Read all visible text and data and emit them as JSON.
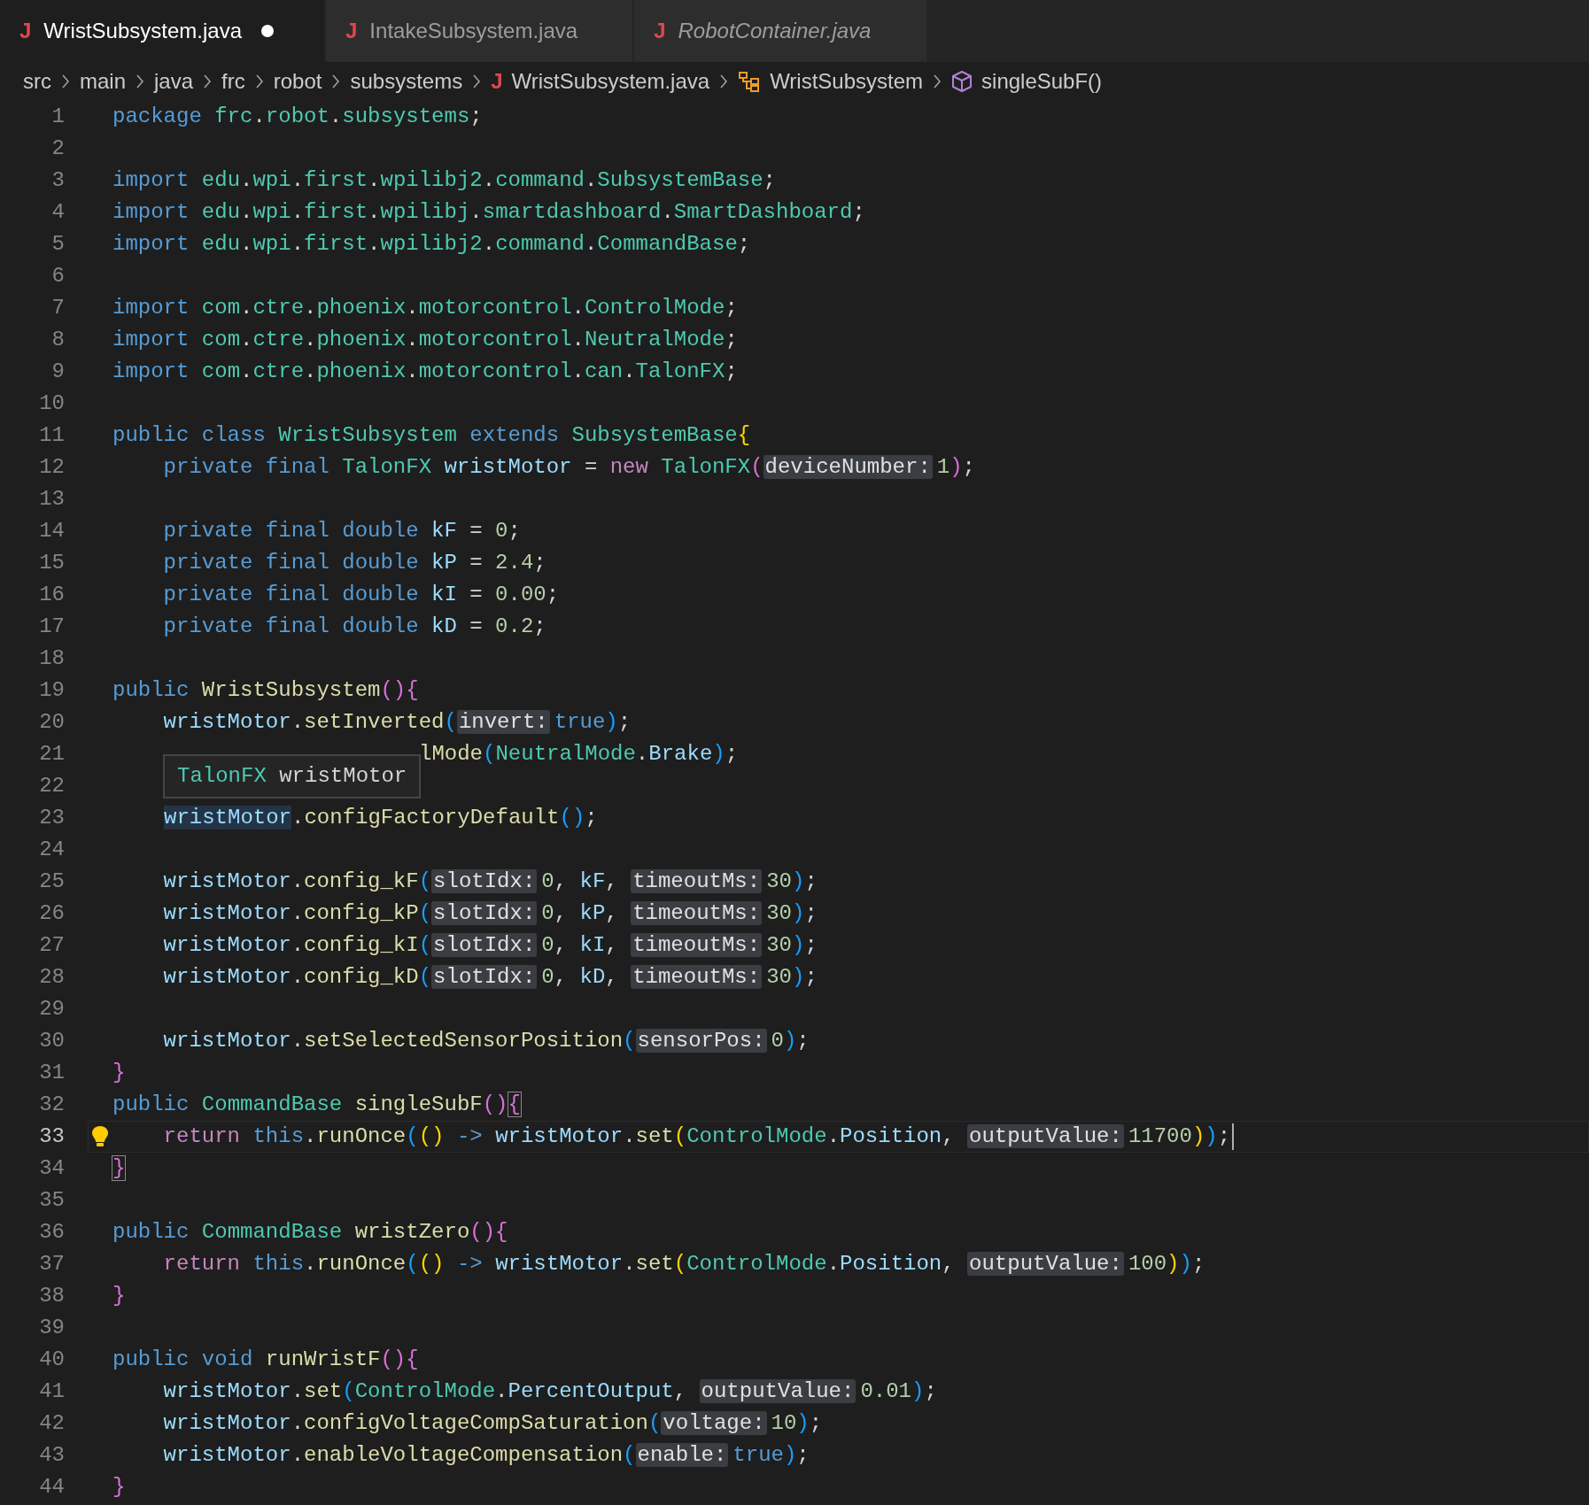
{
  "tabs": [
    {
      "icon": "J",
      "label": "WristSubsystem.java",
      "selected": true,
      "modified": true,
      "preview": false
    },
    {
      "icon": "J",
      "label": "IntakeSubsystem.java",
      "selected": false,
      "modified": false,
      "preview": false
    },
    {
      "icon": "J",
      "label": "RobotContainer.java",
      "selected": false,
      "modified": false,
      "preview": true
    }
  ],
  "breadcrumb": [
    {
      "kind": "folder",
      "label": "src"
    },
    {
      "kind": "folder",
      "label": "main"
    },
    {
      "kind": "folder",
      "label": "java"
    },
    {
      "kind": "folder",
      "label": "frc"
    },
    {
      "kind": "folder",
      "label": "robot"
    },
    {
      "kind": "folder",
      "label": "subsystems"
    },
    {
      "kind": "file",
      "icon": "J",
      "label": "WristSubsystem.java"
    },
    {
      "kind": "class",
      "label": "WristSubsystem"
    },
    {
      "kind": "method",
      "label": "singleSubF()"
    }
  ],
  "lines": [
    {
      "n": "1",
      "tokens": [
        {
          "kind": "kw",
          "text": "package "
        },
        {
          "kind": "ty",
          "text": "frc"
        },
        {
          "kind": "p",
          "text": "."
        },
        {
          "kind": "ty",
          "text": "robot"
        },
        {
          "kind": "p",
          "text": "."
        },
        {
          "kind": "ty",
          "text": "subsystems"
        },
        {
          "kind": "p",
          "text": ";"
        }
      ]
    },
    {
      "n": "2"
    },
    {
      "n": "3",
      "tokens": [
        {
          "kind": "kw",
          "text": "import "
        },
        {
          "kind": "ty",
          "text": "edu"
        },
        {
          "kind": "p",
          "text": "."
        },
        {
          "kind": "ty",
          "text": "wpi"
        },
        {
          "kind": "p",
          "text": "."
        },
        {
          "kind": "ty",
          "text": "first"
        },
        {
          "kind": "p",
          "text": "."
        },
        {
          "kind": "ty",
          "text": "wpilibj2"
        },
        {
          "kind": "p",
          "text": "."
        },
        {
          "kind": "ty",
          "text": "command"
        },
        {
          "kind": "p",
          "text": "."
        },
        {
          "kind": "ty",
          "text": "SubsystemBase"
        },
        {
          "kind": "p",
          "text": ";"
        }
      ]
    },
    {
      "n": "4",
      "tokens": [
        {
          "kind": "kw",
          "text": "import "
        },
        {
          "kind": "ty",
          "text": "edu"
        },
        {
          "kind": "p",
          "text": "."
        },
        {
          "kind": "ty",
          "text": "wpi"
        },
        {
          "kind": "p",
          "text": "."
        },
        {
          "kind": "ty",
          "text": "first"
        },
        {
          "kind": "p",
          "text": "."
        },
        {
          "kind": "ty",
          "text": "wpilibj"
        },
        {
          "kind": "p",
          "text": "."
        },
        {
          "kind": "ty",
          "text": "smartdashboard"
        },
        {
          "kind": "p",
          "text": "."
        },
        {
          "kind": "ty",
          "text": "SmartDashboard"
        },
        {
          "kind": "p",
          "text": ";"
        }
      ]
    },
    {
      "n": "5",
      "tokens": [
        {
          "kind": "kw",
          "text": "import "
        },
        {
          "kind": "ty",
          "text": "edu"
        },
        {
          "kind": "p",
          "text": "."
        },
        {
          "kind": "ty",
          "text": "wpi"
        },
        {
          "kind": "p",
          "text": "."
        },
        {
          "kind": "ty",
          "text": "first"
        },
        {
          "kind": "p",
          "text": "."
        },
        {
          "kind": "ty",
          "text": "wpilibj2"
        },
        {
          "kind": "p",
          "text": "."
        },
        {
          "kind": "ty",
          "text": "command"
        },
        {
          "kind": "p",
          "text": "."
        },
        {
          "kind": "ty",
          "text": "CommandBase"
        },
        {
          "kind": "p",
          "text": ";"
        }
      ]
    },
    {
      "n": "6"
    },
    {
      "n": "7",
      "tokens": [
        {
          "kind": "kw",
          "text": "import "
        },
        {
          "kind": "ty",
          "text": "com"
        },
        {
          "kind": "p",
          "text": "."
        },
        {
          "kind": "ty",
          "text": "ctre"
        },
        {
          "kind": "p",
          "text": "."
        },
        {
          "kind": "ty",
          "text": "phoenix"
        },
        {
          "kind": "p",
          "text": "."
        },
        {
          "kind": "ty",
          "text": "motorcontrol"
        },
        {
          "kind": "p",
          "text": "."
        },
        {
          "kind": "ty",
          "text": "ControlMode"
        },
        {
          "kind": "p",
          "text": ";"
        }
      ]
    },
    {
      "n": "8",
      "tokens": [
        {
          "kind": "kw",
          "text": "import "
        },
        {
          "kind": "ty",
          "text": "com"
        },
        {
          "kind": "p",
          "text": "."
        },
        {
          "kind": "ty",
          "text": "ctre"
        },
        {
          "kind": "p",
          "text": "."
        },
        {
          "kind": "ty",
          "text": "phoenix"
        },
        {
          "kind": "p",
          "text": "."
        },
        {
          "kind": "ty",
          "text": "motorcontrol"
        },
        {
          "kind": "p",
          "text": "."
        },
        {
          "kind": "ty",
          "text": "NeutralMode"
        },
        {
          "kind": "p",
          "text": ";"
        }
      ]
    },
    {
      "n": "9",
      "tokens": [
        {
          "kind": "kw",
          "text": "import "
        },
        {
          "kind": "ty",
          "text": "com"
        },
        {
          "kind": "p",
          "text": "."
        },
        {
          "kind": "ty",
          "text": "ctre"
        },
        {
          "kind": "p",
          "text": "."
        },
        {
          "kind": "ty",
          "text": "phoenix"
        },
        {
          "kind": "p",
          "text": "."
        },
        {
          "kind": "ty",
          "text": "motorcontrol"
        },
        {
          "kind": "p",
          "text": "."
        },
        {
          "kind": "ty",
          "text": "can"
        },
        {
          "kind": "p",
          "text": "."
        },
        {
          "kind": "ty",
          "text": "TalonFX"
        },
        {
          "kind": "p",
          "text": ";"
        }
      ]
    },
    {
      "n": "10"
    },
    {
      "n": "11",
      "tokens": [
        {
          "kind": "kw",
          "text": "public class "
        },
        {
          "kind": "ty",
          "text": "WristSubsystem "
        },
        {
          "kind": "kw",
          "text": "extends "
        },
        {
          "kind": "ty",
          "text": "SubsystemBase"
        },
        {
          "kind": "b1",
          "text": "{"
        }
      ]
    },
    {
      "n": "12",
      "tokens": [
        {
          "kind": "kw",
          "text": "    private final "
        },
        {
          "kind": "ty",
          "text": "TalonFX "
        },
        {
          "kind": "v",
          "text": "wristMotor"
        },
        {
          "kind": "p",
          "text": " = "
        },
        {
          "kind": "ctl",
          "text": "new "
        },
        {
          "kind": "ty",
          "text": "TalonFX"
        },
        {
          "kind": "b2",
          "text": "("
        },
        {
          "kind": "hint",
          "text": "deviceNumber:"
        },
        {
          "kind": "n",
          "text": "1"
        },
        {
          "kind": "b2",
          "text": ")"
        },
        {
          "kind": "p",
          "text": ";"
        }
      ]
    },
    {
      "n": "13"
    },
    {
      "n": "14",
      "tokens": [
        {
          "kind": "kw",
          "text": "    private final double "
        },
        {
          "kind": "v",
          "text": "kF"
        },
        {
          "kind": "p",
          "text": " = "
        },
        {
          "kind": "n",
          "text": "0"
        },
        {
          "kind": "p",
          "text": ";"
        }
      ]
    },
    {
      "n": "15",
      "tokens": [
        {
          "kind": "kw",
          "text": "    private final double "
        },
        {
          "kind": "v",
          "text": "kP"
        },
        {
          "kind": "p",
          "text": " = "
        },
        {
          "kind": "n",
          "text": "2.4"
        },
        {
          "kind": "p",
          "text": ";"
        }
      ]
    },
    {
      "n": "16",
      "tokens": [
        {
          "kind": "kw",
          "text": "    private final double "
        },
        {
          "kind": "v",
          "text": "kI"
        },
        {
          "kind": "p",
          "text": " = "
        },
        {
          "kind": "n",
          "text": "0.00"
        },
        {
          "kind": "p",
          "text": ";"
        }
      ]
    },
    {
      "n": "17",
      "tokens": [
        {
          "kind": "kw",
          "text": "    private final double "
        },
        {
          "kind": "v",
          "text": "kD"
        },
        {
          "kind": "p",
          "text": " = "
        },
        {
          "kind": "n",
          "text": "0.2"
        },
        {
          "kind": "p",
          "text": ";"
        }
      ]
    },
    {
      "n": "18"
    },
    {
      "n": "19",
      "tokens": [
        {
          "kind": "kw",
          "text": "public "
        },
        {
          "kind": "fn",
          "text": "WristSubsystem"
        },
        {
          "kind": "b2",
          "text": "(){"
        }
      ]
    },
    {
      "n": "20",
      "tokens": [
        {
          "kind": "v",
          "text": "    wristMotor"
        },
        {
          "kind": "p",
          "text": "."
        },
        {
          "kind": "fn",
          "text": "setInverted"
        },
        {
          "kind": "b3",
          "text": "("
        },
        {
          "kind": "hint",
          "text": "invert:"
        },
        {
          "kind": "kw",
          "text": "true"
        },
        {
          "kind": "b3",
          "text": ")"
        },
        {
          "kind": "p",
          "text": ";"
        }
      ]
    },
    {
      "n": "21",
      "tokens": [
        {
          "kind": "fn",
          "text": "lMode"
        },
        {
          "kind": "b3",
          "text": "("
        },
        {
          "kind": "ty",
          "text": "NeutralMode"
        },
        {
          "kind": "p",
          "text": "."
        },
        {
          "kind": "v",
          "text": "Brake"
        },
        {
          "kind": "b3",
          "text": ")"
        },
        {
          "kind": "p",
          "text": ";"
        }
      ],
      "hover": [
        {
          "kind": "ty",
          "text": "TalonFX "
        },
        {
          "kind": "p",
          "text": "wristMotor"
        }
      ]
    },
    {
      "n": "22"
    },
    {
      "n": "23",
      "tokens": [
        {
          "kind": "hl",
          "text": "wristMotor"
        },
        {
          "kind": "p",
          "text": "."
        },
        {
          "kind": "fn",
          "text": "configFactoryDefault"
        },
        {
          "kind": "b3",
          "text": "()"
        },
        {
          "kind": "p",
          "text": ";"
        }
      ]
    },
    {
      "n": "24"
    },
    {
      "n": "25",
      "tokens": [
        {
          "kind": "v",
          "text": "    wristMotor"
        },
        {
          "kind": "p",
          "text": "."
        },
        {
          "kind": "fn",
          "text": "config_kF"
        },
        {
          "kind": "b3",
          "text": "("
        },
        {
          "kind": "hint",
          "text": "slotIdx:"
        },
        {
          "kind": "n",
          "text": "0"
        },
        {
          "kind": "p",
          "text": ", "
        },
        {
          "kind": "v",
          "text": "kF"
        },
        {
          "kind": "p",
          "text": ", "
        },
        {
          "kind": "hint",
          "text": "timeoutMs:"
        },
        {
          "kind": "n",
          "text": "30"
        },
        {
          "kind": "b3",
          "text": ")"
        },
        {
          "kind": "p",
          "text": ";"
        }
      ]
    },
    {
      "n": "26",
      "tokens": [
        {
          "kind": "v",
          "text": "    wristMotor"
        },
        {
          "kind": "p",
          "text": "."
        },
        {
          "kind": "fn",
          "text": "config_kP"
        },
        {
          "kind": "b3",
          "text": "("
        },
        {
          "kind": "hint",
          "text": "slotIdx:"
        },
        {
          "kind": "n",
          "text": "0"
        },
        {
          "kind": "p",
          "text": ", "
        },
        {
          "kind": "v",
          "text": "kP"
        },
        {
          "kind": "p",
          "text": ", "
        },
        {
          "kind": "hint",
          "text": "timeoutMs:"
        },
        {
          "kind": "n",
          "text": "30"
        },
        {
          "kind": "b3",
          "text": ")"
        },
        {
          "kind": "p",
          "text": ";"
        }
      ]
    },
    {
      "n": "27",
      "tokens": [
        {
          "kind": "v",
          "text": "    wristMotor"
        },
        {
          "kind": "p",
          "text": "."
        },
        {
          "kind": "fn",
          "text": "config_kI"
        },
        {
          "kind": "b3",
          "text": "("
        },
        {
          "kind": "hint",
          "text": "slotIdx:"
        },
        {
          "kind": "n",
          "text": "0"
        },
        {
          "kind": "p",
          "text": ", "
        },
        {
          "kind": "v",
          "text": "kI"
        },
        {
          "kind": "p",
          "text": ", "
        },
        {
          "kind": "hint",
          "text": "timeoutMs:"
        },
        {
          "kind": "n",
          "text": "30"
        },
        {
          "kind": "b3",
          "text": ")"
        },
        {
          "kind": "p",
          "text": ";"
        }
      ]
    },
    {
      "n": "28",
      "tokens": [
        {
          "kind": "v",
          "text": "    wristMotor"
        },
        {
          "kind": "p",
          "text": "."
        },
        {
          "kind": "fn",
          "text": "config_kD"
        },
        {
          "kind": "b3",
          "text": "("
        },
        {
          "kind": "hint",
          "text": "slotIdx:"
        },
        {
          "kind": "n",
          "text": "0"
        },
        {
          "kind": "p",
          "text": ", "
        },
        {
          "kind": "v",
          "text": "kD"
        },
        {
          "kind": "p",
          "text": ", "
        },
        {
          "kind": "hint",
          "text": "timeoutMs:"
        },
        {
          "kind": "n",
          "text": "30"
        },
        {
          "kind": "b3",
          "text": ")"
        },
        {
          "kind": "p",
          "text": ";"
        }
      ]
    },
    {
      "n": "29"
    },
    {
      "n": "30",
      "tokens": [
        {
          "kind": "v",
          "text": "    wristMotor"
        },
        {
          "kind": "p",
          "text": "."
        },
        {
          "kind": "fn",
          "text": "setSelectedSensorPosition"
        },
        {
          "kind": "b3",
          "text": "("
        },
        {
          "kind": "hint",
          "text": "sensorPos:"
        },
        {
          "kind": "n",
          "text": "0"
        },
        {
          "kind": "b3",
          "text": ")"
        },
        {
          "kind": "p",
          "text": ";"
        }
      ]
    },
    {
      "n": "31",
      "tokens": [
        {
          "kind": "b2",
          "text": "}"
        }
      ]
    },
    {
      "n": "32",
      "tokens": [
        {
          "kind": "kw",
          "text": "public "
        },
        {
          "kind": "ty",
          "text": "CommandBase "
        },
        {
          "kind": "fn",
          "text": "singleSubF"
        },
        {
          "kind": "b2",
          "text": "()"
        },
        {
          "kind": "bm",
          "text": "{"
        }
      ]
    },
    {
      "n": "33",
      "current": true,
      "lightbulb": true,
      "cursor": true,
      "tokens": [
        {
          "kind": "ctl",
          "text": "    return "
        },
        {
          "kind": "kw",
          "text": "this"
        },
        {
          "kind": "p",
          "text": "."
        },
        {
          "kind": "fn",
          "text": "runOnce"
        },
        {
          "kind": "b3",
          "text": "("
        },
        {
          "kind": "b1",
          "text": "() "
        },
        {
          "kind": "kw",
          "text": "-> "
        },
        {
          "kind": "v",
          "text": "wristMotor"
        },
        {
          "kind": "p",
          "text": "."
        },
        {
          "kind": "fn",
          "text": "set"
        },
        {
          "kind": "b1",
          "text": "("
        },
        {
          "kind": "ty",
          "text": "ControlMode"
        },
        {
          "kind": "p",
          "text": "."
        },
        {
          "kind": "v",
          "text": "Position"
        },
        {
          "kind": "p",
          "text": ", "
        },
        {
          "kind": "hint",
          "text": "outputValue:"
        },
        {
          "kind": "n",
          "text": "11700"
        },
        {
          "kind": "b1",
          "text": ")"
        },
        {
          "kind": "b3",
          "text": ")"
        },
        {
          "kind": "p",
          "text": ";"
        }
      ]
    },
    {
      "n": "34",
      "tokens": [
        {
          "kind": "bm",
          "text": "}"
        }
      ]
    },
    {
      "n": "35"
    },
    {
      "n": "36",
      "tokens": [
        {
          "kind": "kw",
          "text": "public "
        },
        {
          "kind": "ty",
          "text": "CommandBase "
        },
        {
          "kind": "fn",
          "text": "wristZero"
        },
        {
          "kind": "b2",
          "text": "(){"
        }
      ]
    },
    {
      "n": "37",
      "tokens": [
        {
          "kind": "ctl",
          "text": "    return "
        },
        {
          "kind": "kw",
          "text": "this"
        },
        {
          "kind": "p",
          "text": "."
        },
        {
          "kind": "fn",
          "text": "runOnce"
        },
        {
          "kind": "b3",
          "text": "("
        },
        {
          "kind": "b1",
          "text": "() "
        },
        {
          "kind": "kw",
          "text": "-> "
        },
        {
          "kind": "v",
          "text": "wristMotor"
        },
        {
          "kind": "p",
          "text": "."
        },
        {
          "kind": "fn",
          "text": "set"
        },
        {
          "kind": "b1",
          "text": "("
        },
        {
          "kind": "ty",
          "text": "ControlMode"
        },
        {
          "kind": "p",
          "text": "."
        },
        {
          "kind": "v",
          "text": "Position"
        },
        {
          "kind": "p",
          "text": ", "
        },
        {
          "kind": "hint",
          "text": "outputValue:"
        },
        {
          "kind": "n",
          "text": "100"
        },
        {
          "kind": "b1",
          "text": ")"
        },
        {
          "kind": "b3",
          "text": ")"
        },
        {
          "kind": "p",
          "text": ";"
        }
      ]
    },
    {
      "n": "38",
      "tokens": [
        {
          "kind": "b2",
          "text": "}"
        }
      ]
    },
    {
      "n": "39"
    },
    {
      "n": "40",
      "tokens": [
        {
          "kind": "kw",
          "text": "public void "
        },
        {
          "kind": "fn",
          "text": "runWristF"
        },
        {
          "kind": "b2",
          "text": "(){"
        }
      ]
    },
    {
      "n": "41",
      "tokens": [
        {
          "kind": "v",
          "text": "    wristMotor"
        },
        {
          "kind": "p",
          "text": "."
        },
        {
          "kind": "fn",
          "text": "set"
        },
        {
          "kind": "b3",
          "text": "("
        },
        {
          "kind": "ty",
          "text": "ControlMode"
        },
        {
          "kind": "p",
          "text": "."
        },
        {
          "kind": "v",
          "text": "PercentOutput"
        },
        {
          "kind": "p",
          "text": ", "
        },
        {
          "kind": "hint",
          "text": "outputValue:"
        },
        {
          "kind": "n",
          "text": "0.01"
        },
        {
          "kind": "b3",
          "text": ")"
        },
        {
          "kind": "p",
          "text": ";"
        }
      ]
    },
    {
      "n": "42",
      "tokens": [
        {
          "kind": "v",
          "text": "    wristMotor"
        },
        {
          "kind": "p",
          "text": "."
        },
        {
          "kind": "fn",
          "text": "configVoltageCompSaturation"
        },
        {
          "kind": "b3",
          "text": "("
        },
        {
          "kind": "hint",
          "text": "voltage:"
        },
        {
          "kind": "n",
          "text": "10"
        },
        {
          "kind": "b3",
          "text": ")"
        },
        {
          "kind": "p",
          "text": ";"
        }
      ]
    },
    {
      "n": "43",
      "tokens": [
        {
          "kind": "v",
          "text": "    wristMotor"
        },
        {
          "kind": "p",
          "text": "."
        },
        {
          "kind": "fn",
          "text": "enableVoltageCompensation"
        },
        {
          "kind": "b3",
          "text": "("
        },
        {
          "kind": "hint",
          "text": "enable:"
        },
        {
          "kind": "kw",
          "text": "true"
        },
        {
          "kind": "b3",
          "text": ")"
        },
        {
          "kind": "p",
          "text": ";"
        }
      ]
    },
    {
      "n": "44",
      "tokens": [
        {
          "kind": "b2",
          "text": "}"
        }
      ]
    }
  ]
}
